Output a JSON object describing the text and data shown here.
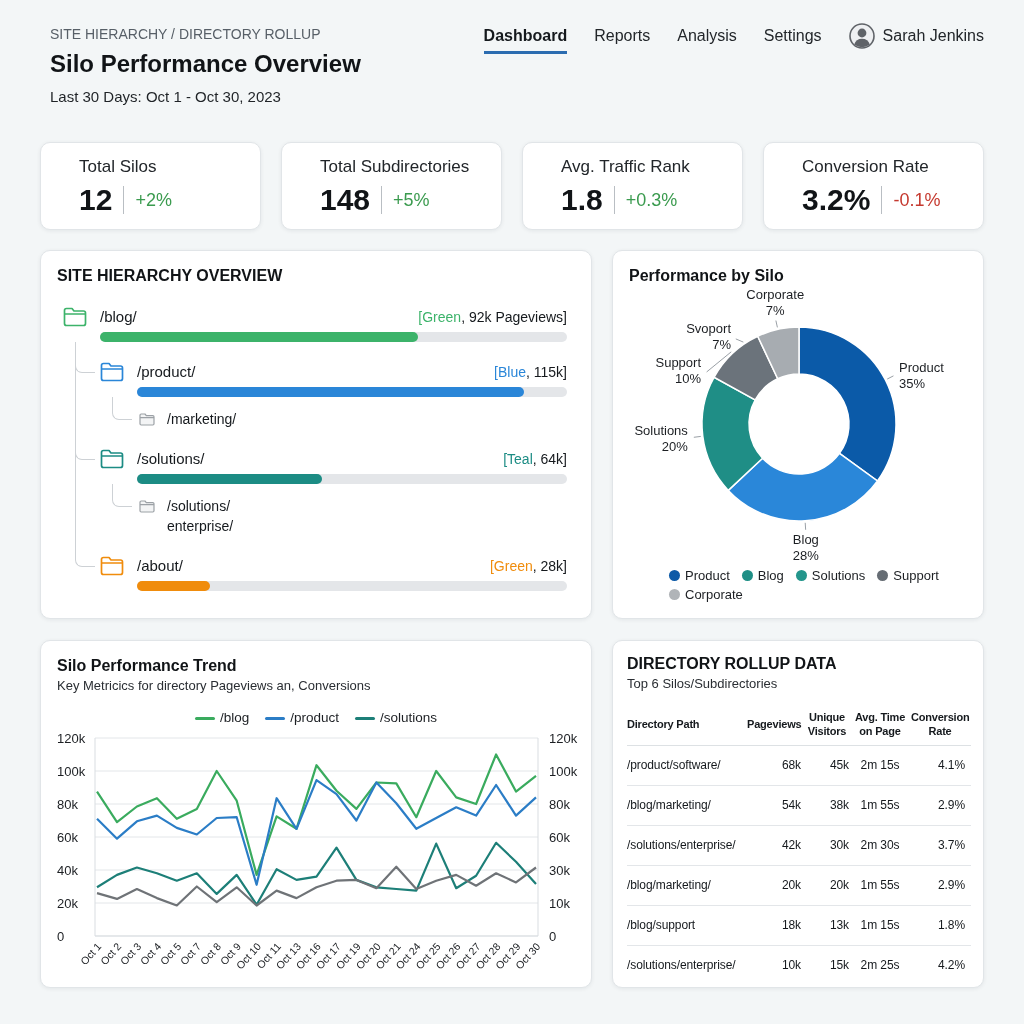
{
  "header": {
    "breadcrumb": "SITE HIERARCHY / DIRECTORY ROLLUP",
    "title": "Silo Performance Overview",
    "date_range": "Last 30 Days: Oct 1 - Oct 30, 2023"
  },
  "nav": {
    "tabs": [
      {
        "label": "Dashboard",
        "selected": true
      },
      {
        "label": "Reports",
        "selected": false
      },
      {
        "label": "Analysis",
        "selected": false
      },
      {
        "label": "Settings",
        "selected": false
      }
    ],
    "user": {
      "name": "Sarah Jenkins"
    }
  },
  "kpis": [
    {
      "label": "Total Silos",
      "value": "12",
      "change": "+2%",
      "negative": false
    },
    {
      "label": "Total Subdirectories",
      "value": "148",
      "change": "+5%",
      "negative": false
    },
    {
      "label": "Avg. Traffic Rank",
      "value": "1.8",
      "change": "+0.3%",
      "negative": false
    },
    {
      "label": "Conversion Rate",
      "value": "3.2%",
      "change": "-0.1%",
      "negative": true
    }
  ],
  "hierarchy": {
    "title": "SITE HIERARCHY OVERVIEW",
    "tree": [
      {
        "label": "/blog/",
        "color": "#3cb36a",
        "tag": "[Green",
        "figure": ", 92k Pageviews]",
        "level": 0.68,
        "children": [
          {
            "label": "/product/",
            "color": "#2a86d8",
            "tag": "[Blue",
            "figure": ", 115k]",
            "level": 0.9,
            "children": [
              {
                "label": "/marketing/"
              }
            ]
          },
          {
            "label": "/solutions/",
            "color": "#1c8c84",
            "tag": "[Teal",
            "figure": ", 64k]",
            "level": 0.43,
            "children": [
              {
                "label": "/solutions/enterprise/"
              }
            ]
          },
          {
            "label": "/about/",
            "color": "#f08c0c",
            "tag": "[Green",
            "figure": ", 28k]",
            "level": 0.17
          }
        ]
      }
    ]
  },
  "performance": {
    "title": "Performance by Silo",
    "chart_data": {
      "type": "donut",
      "categories": [
        "Product",
        "Blog",
        "Solutions",
        "Support",
        "Corporate"
      ],
      "values": [
        35,
        28,
        20,
        10,
        7
      ],
      "colors": [
        "#0b5aa8",
        "#2a87d9",
        "#1f8e86",
        "#6b737b",
        "#a7acb1"
      ],
      "value_labels": [
        "35%",
        "28%",
        "20%",
        "10%",
        "7%"
      ],
      "annotations": [
        {
          "text": "Svoport 7%"
        }
      ]
    },
    "legend": [
      {
        "label": "Product",
        "color": "#0d5aa7"
      },
      {
        "label": "Blog",
        "color": "#1f8f86"
      },
      {
        "label": "Solutions",
        "color": "#24968c"
      },
      {
        "label": "Support",
        "color": "#666d74"
      },
      {
        "label": "Corporate",
        "color": "#b0b4b8"
      }
    ]
  },
  "trend": {
    "title": "Silo Performance Trend",
    "subtitle": "Key Metricics for directory Pageviews an, Conversions",
    "chart_data": {
      "type": "line",
      "categories": [
        "Oct 1",
        "Oct 2",
        "Oct 3",
        "Oct 4",
        "Oct 5",
        "Oct 7",
        "Oct 8",
        "Oct 9",
        "Oct 10",
        "Oct 11",
        "Oct 13",
        "Oct 16",
        "Oct 17",
        "Oct 19",
        "Oct 20",
        "Oct 21",
        "Oct 24",
        "Oct 25",
        "Oct 26",
        "Oct 27",
        "Oct 28",
        "Oct 29",
        "Oct 30"
      ],
      "series": [
        {
          "name": "/blog",
          "color": "#3aab5e",
          "values": [
            87.5,
            69,
            78.5,
            83.5,
            71,
            77,
            100,
            82,
            37,
            72.5,
            65,
            103.5,
            88,
            77,
            93,
            92.5,
            72,
            100,
            84,
            80,
            110,
            87.5,
            97
          ]
        },
        {
          "name": "/product",
          "color": "#2b7dc6",
          "values": [
            71,
            59,
            69.5,
            73,
            65.5,
            61.5,
            71.5,
            72,
            31,
            83.5,
            65,
            94.5,
            86,
            70,
            93,
            80.5,
            65,
            71.5,
            78,
            73,
            91.5,
            73,
            84
          ]
        },
        {
          "name": "/solutions",
          "color": "#1d7f78",
          "values": [
            29.5,
            37,
            41.5,
            38,
            33.5,
            38,
            25.5,
            37,
            19,
            40.5,
            34,
            36,
            53.5,
            34,
            29.5,
            28.5,
            27.5,
            56,
            29,
            36.5,
            56.5,
            45,
            31.5
          ]
        },
        {
          "color": "#6f7377",
          "values": [
            26,
            22.5,
            28.5,
            23,
            18.5,
            30,
            20.5,
            29.5,
            18.5,
            27.5,
            23,
            29.5,
            33.5,
            34,
            29,
            42,
            28.5,
            33.5,
            37,
            30.5,
            38,
            32.5,
            41.5
          ]
        }
      ],
      "ylim": [
        0,
        120
      ],
      "yticks": [
        {
          "value": 0,
          "label": "0"
        },
        {
          "value": 20,
          "label": "20k"
        },
        {
          "value": 40,
          "label": "40k"
        },
        {
          "value": 60,
          "label": "60k"
        },
        {
          "value": 80,
          "label": "80k"
        },
        {
          "value": 100,
          "label": "100k"
        },
        {
          "value": 120,
          "label": "120k"
        }
      ],
      "grid": true
    },
    "right_axis_labels": [
      "120k",
      "100k",
      "80k",
      "60k",
      "30k",
      "10k",
      "0"
    ]
  },
  "rollup": {
    "title": "DIRECTORY ROLLUP DATA",
    "subtitle": "Top 6 Silos/Subdirectories",
    "columns": [
      "Directory Path",
      "Pageviews",
      "Unique Visitors",
      "Avg. Time on Page",
      "Conversion Rate"
    ],
    "rows": [
      [
        "/product/software/",
        "68k",
        "45k",
        "2m 15s",
        "4.1%"
      ],
      [
        "/blog/marketing/",
        "54k",
        "38k",
        "1m 55s",
        "2.9%"
      ],
      [
        "/solutions/enterprise/",
        "42k",
        "30k",
        "2m 30s",
        "3.7%"
      ],
      [
        "/blog/marketing/",
        "20k",
        "20k",
        "1m 55s",
        "2.9%"
      ],
      [
        "/blog/support",
        "18k",
        "13k",
        "1m 15s",
        "1.8%"
      ],
      [
        "/solutions/enterprise/",
        "10k",
        "15k",
        "2m 25s",
        "4.2%"
      ]
    ]
  }
}
